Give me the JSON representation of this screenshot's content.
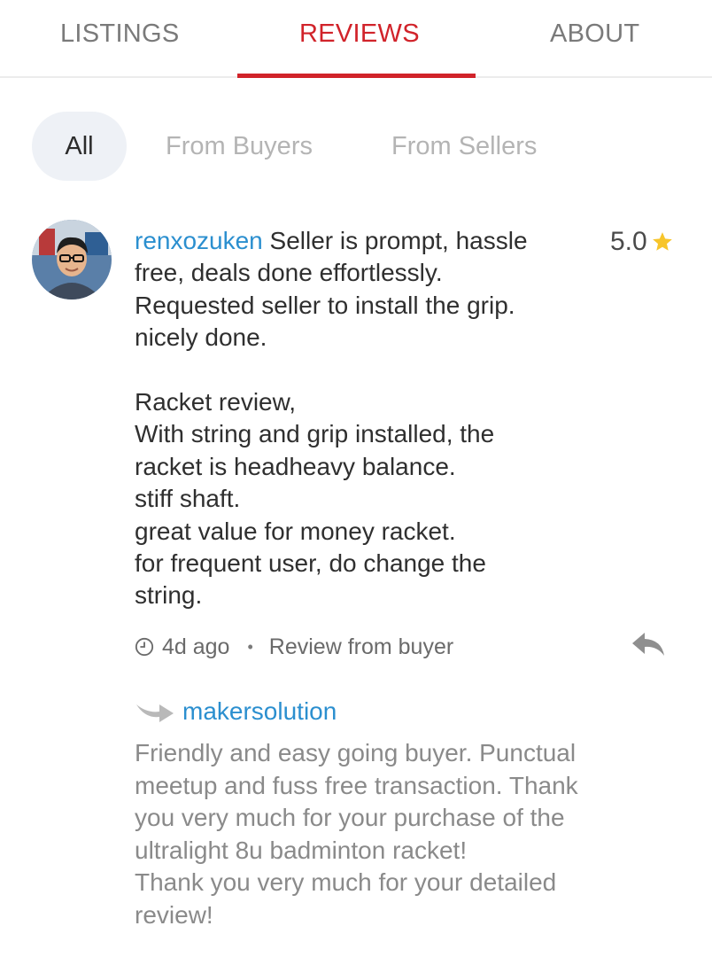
{
  "tabs": [
    {
      "label": "LISTINGS",
      "active": false
    },
    {
      "label": "REVIEWS",
      "active": true
    },
    {
      "label": "ABOUT",
      "active": false
    }
  ],
  "filters": [
    {
      "label": "All",
      "active": true
    },
    {
      "label": "From Buyers",
      "active": false
    },
    {
      "label": "From Sellers",
      "active": false
    }
  ],
  "review": {
    "username": "renxozuken",
    "body": " Seller is prompt, hassle\nfree, deals done effortlessly.\nRequested seller to install the grip.\nnicely done.\n\nRacket review,\nWith string and grip installed, the\nracket is headheavy balance.\nstiff shaft.\ngreat value for money racket.\nfor frequent user, do change the\nstring.",
    "rating": "5.0",
    "time": "4d ago",
    "source": "Review from buyer",
    "star_color": "#f7c52b",
    "icons": [
      "avatar",
      "star-icon",
      "clock-icon",
      "reply-icon"
    ]
  },
  "reply": {
    "username": "makersolution",
    "body": "Friendly and easy going buyer. Punctual\nmeetup and fuss free transaction. Thank\nyou very much for your purchase of the\nultralight 8u badminton racket!\nThank you very much for your detailed\nreview!",
    "icon": "reply-arrow-icon"
  },
  "colors": {
    "accent": "#d1232a",
    "link": "#2b8fcf",
    "filter_bg": "#eef1f6"
  }
}
